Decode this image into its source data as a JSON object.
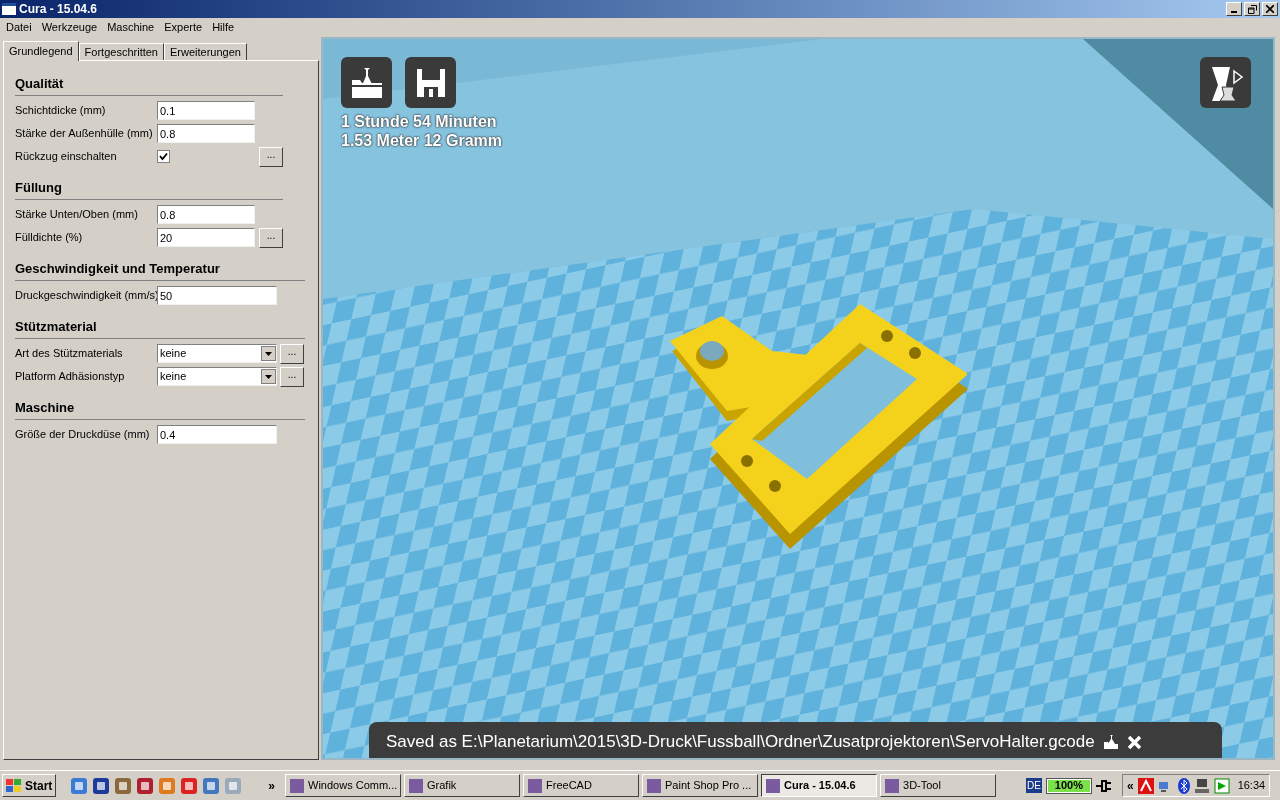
{
  "window": {
    "title": "Cura - 15.04.6"
  },
  "menu": [
    "Datei",
    "Werkzeuge",
    "Maschine",
    "Experte",
    "Hilfe"
  ],
  "tabs": [
    {
      "label": "Grundlegend",
      "selected": true
    },
    {
      "label": "Fortgeschritten",
      "selected": false
    },
    {
      "label": "Erweiterungen",
      "selected": false
    }
  ],
  "sections": [
    {
      "title": "Qualität",
      "fields": [
        {
          "kind": "text",
          "label": "Schichtdicke (mm)",
          "value": "0.1",
          "wide": false
        },
        {
          "kind": "text",
          "label": "Stärke der Außenhülle (mm)",
          "value": "0.8",
          "wide": false
        },
        {
          "kind": "checkbox",
          "label": "Rückzug einschalten",
          "checked": true,
          "more": "..."
        }
      ]
    },
    {
      "title": "Füllung",
      "fields": [
        {
          "kind": "text",
          "label": "Stärke Unten/Oben (mm)",
          "value": "0.8",
          "wide": false
        },
        {
          "kind": "text",
          "label": "Fülldichte (%)",
          "value": "20",
          "wide": false,
          "more": "..."
        }
      ]
    },
    {
      "title": "Geschwindigkeit und Temperatur",
      "fields": [
        {
          "kind": "text",
          "label": "Druckgeschwindigkeit (mm/s)",
          "value": "50",
          "wide": true
        }
      ]
    },
    {
      "title": "Stützmaterial",
      "fields": [
        {
          "kind": "select",
          "label": "Art des Stützmaterials",
          "value": "keine",
          "more": "..."
        },
        {
          "kind": "select",
          "label": "Platform Adhäsionstyp",
          "value": "keine",
          "more": "..."
        }
      ]
    },
    {
      "title": "Maschine",
      "fields": [
        {
          "kind": "text",
          "label": "Größe der Druckdüse (mm)",
          "value": "0.4",
          "wide": true
        }
      ]
    }
  ],
  "viewport": {
    "info": [
      "1 Stunde 54 Minuten",
      "1.53 Meter 12 Gramm"
    ],
    "notification": "Saved as E:\\Planetarium\\2015\\3D-Druck\\Fussball\\Ordner\\Zusatprojektoren\\ServoHalter.gcode"
  },
  "taskbar": {
    "start": "Start",
    "more": "»",
    "tasks": [
      {
        "label": "Windows Comm...",
        "selected": false
      },
      {
        "label": "Grafik",
        "selected": false
      },
      {
        "label": "FreeCAD",
        "selected": false
      },
      {
        "label": "Paint Shop Pro ...",
        "selected": false
      },
      {
        "label": "Cura - 15.04.6",
        "selected": true
      },
      {
        "label": "3D-Tool",
        "selected": false
      }
    ],
    "language": "DE",
    "battery": {
      "label": "100%",
      "level": 1
    },
    "tray_expand": "«",
    "time": "16:34"
  }
}
